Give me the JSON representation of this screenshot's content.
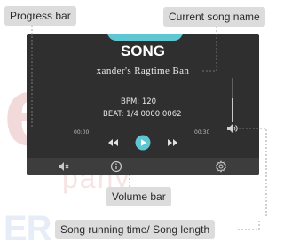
{
  "callouts": {
    "progress_bar": "Progress bar",
    "current_song_name": "Current song name",
    "volume_bar": "Volume bar",
    "song_time": "Song running time/ Song length"
  },
  "screen": {
    "title": "SONG",
    "song_name": "xander's Ragtime Ban",
    "bpm": "BPM: 120",
    "beat": "BEAT:   1/4 0000 0062",
    "time_current": "00:00",
    "time_length": "00:30"
  },
  "player": {
    "progress_fraction": 0,
    "volume_fraction": 0.55
  },
  "icons": [
    "previous-icon",
    "play-icon",
    "next-icon",
    "volume-icon",
    "mute-icon",
    "info-icon",
    "settings-icon"
  ],
  "colors": {
    "accent": "#5fc6d2",
    "screen_bg": "#2f2f2f",
    "callout_bg": "#dcdcdc"
  }
}
